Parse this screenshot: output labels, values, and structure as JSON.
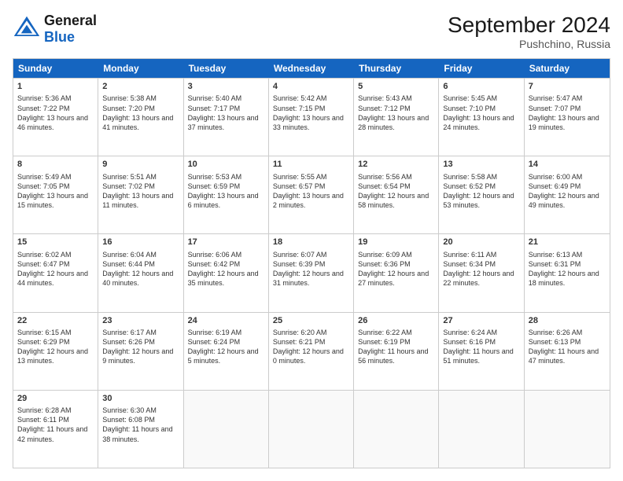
{
  "header": {
    "logo_line1": "General",
    "logo_line2": "Blue",
    "month": "September 2024",
    "location": "Pushchino, Russia"
  },
  "days": [
    "Sunday",
    "Monday",
    "Tuesday",
    "Wednesday",
    "Thursday",
    "Friday",
    "Saturday"
  ],
  "weeks": [
    [
      {
        "day": "1",
        "text": "Sunrise: 5:36 AM\nSunset: 7:22 PM\nDaylight: 13 hours and 46 minutes."
      },
      {
        "day": "2",
        "text": "Sunrise: 5:38 AM\nSunset: 7:20 PM\nDaylight: 13 hours and 41 minutes."
      },
      {
        "day": "3",
        "text": "Sunrise: 5:40 AM\nSunset: 7:17 PM\nDaylight: 13 hours and 37 minutes."
      },
      {
        "day": "4",
        "text": "Sunrise: 5:42 AM\nSunset: 7:15 PM\nDaylight: 13 hours and 33 minutes."
      },
      {
        "day": "5",
        "text": "Sunrise: 5:43 AM\nSunset: 7:12 PM\nDaylight: 13 hours and 28 minutes."
      },
      {
        "day": "6",
        "text": "Sunrise: 5:45 AM\nSunset: 7:10 PM\nDaylight: 13 hours and 24 minutes."
      },
      {
        "day": "7",
        "text": "Sunrise: 5:47 AM\nSunset: 7:07 PM\nDaylight: 13 hours and 19 minutes."
      }
    ],
    [
      {
        "day": "8",
        "text": "Sunrise: 5:49 AM\nSunset: 7:05 PM\nDaylight: 13 hours and 15 minutes."
      },
      {
        "day": "9",
        "text": "Sunrise: 5:51 AM\nSunset: 7:02 PM\nDaylight: 13 hours and 11 minutes."
      },
      {
        "day": "10",
        "text": "Sunrise: 5:53 AM\nSunset: 6:59 PM\nDaylight: 13 hours and 6 minutes."
      },
      {
        "day": "11",
        "text": "Sunrise: 5:55 AM\nSunset: 6:57 PM\nDaylight: 13 hours and 2 minutes."
      },
      {
        "day": "12",
        "text": "Sunrise: 5:56 AM\nSunset: 6:54 PM\nDaylight: 12 hours and 58 minutes."
      },
      {
        "day": "13",
        "text": "Sunrise: 5:58 AM\nSunset: 6:52 PM\nDaylight: 12 hours and 53 minutes."
      },
      {
        "day": "14",
        "text": "Sunrise: 6:00 AM\nSunset: 6:49 PM\nDaylight: 12 hours and 49 minutes."
      }
    ],
    [
      {
        "day": "15",
        "text": "Sunrise: 6:02 AM\nSunset: 6:47 PM\nDaylight: 12 hours and 44 minutes."
      },
      {
        "day": "16",
        "text": "Sunrise: 6:04 AM\nSunset: 6:44 PM\nDaylight: 12 hours and 40 minutes."
      },
      {
        "day": "17",
        "text": "Sunrise: 6:06 AM\nSunset: 6:42 PM\nDaylight: 12 hours and 35 minutes."
      },
      {
        "day": "18",
        "text": "Sunrise: 6:07 AM\nSunset: 6:39 PM\nDaylight: 12 hours and 31 minutes."
      },
      {
        "day": "19",
        "text": "Sunrise: 6:09 AM\nSunset: 6:36 PM\nDaylight: 12 hours and 27 minutes."
      },
      {
        "day": "20",
        "text": "Sunrise: 6:11 AM\nSunset: 6:34 PM\nDaylight: 12 hours and 22 minutes."
      },
      {
        "day": "21",
        "text": "Sunrise: 6:13 AM\nSunset: 6:31 PM\nDaylight: 12 hours and 18 minutes."
      }
    ],
    [
      {
        "day": "22",
        "text": "Sunrise: 6:15 AM\nSunset: 6:29 PM\nDaylight: 12 hours and 13 minutes."
      },
      {
        "day": "23",
        "text": "Sunrise: 6:17 AM\nSunset: 6:26 PM\nDaylight: 12 hours and 9 minutes."
      },
      {
        "day": "24",
        "text": "Sunrise: 6:19 AM\nSunset: 6:24 PM\nDaylight: 12 hours and 5 minutes."
      },
      {
        "day": "25",
        "text": "Sunrise: 6:20 AM\nSunset: 6:21 PM\nDaylight: 12 hours and 0 minutes."
      },
      {
        "day": "26",
        "text": "Sunrise: 6:22 AM\nSunset: 6:19 PM\nDaylight: 11 hours and 56 minutes."
      },
      {
        "day": "27",
        "text": "Sunrise: 6:24 AM\nSunset: 6:16 PM\nDaylight: 11 hours and 51 minutes."
      },
      {
        "day": "28",
        "text": "Sunrise: 6:26 AM\nSunset: 6:13 PM\nDaylight: 11 hours and 47 minutes."
      }
    ],
    [
      {
        "day": "29",
        "text": "Sunrise: 6:28 AM\nSunset: 6:11 PM\nDaylight: 11 hours and 42 minutes."
      },
      {
        "day": "30",
        "text": "Sunrise: 6:30 AM\nSunset: 6:08 PM\nDaylight: 11 hours and 38 minutes."
      },
      {
        "day": "",
        "text": ""
      },
      {
        "day": "",
        "text": ""
      },
      {
        "day": "",
        "text": ""
      },
      {
        "day": "",
        "text": ""
      },
      {
        "day": "",
        "text": ""
      }
    ]
  ]
}
